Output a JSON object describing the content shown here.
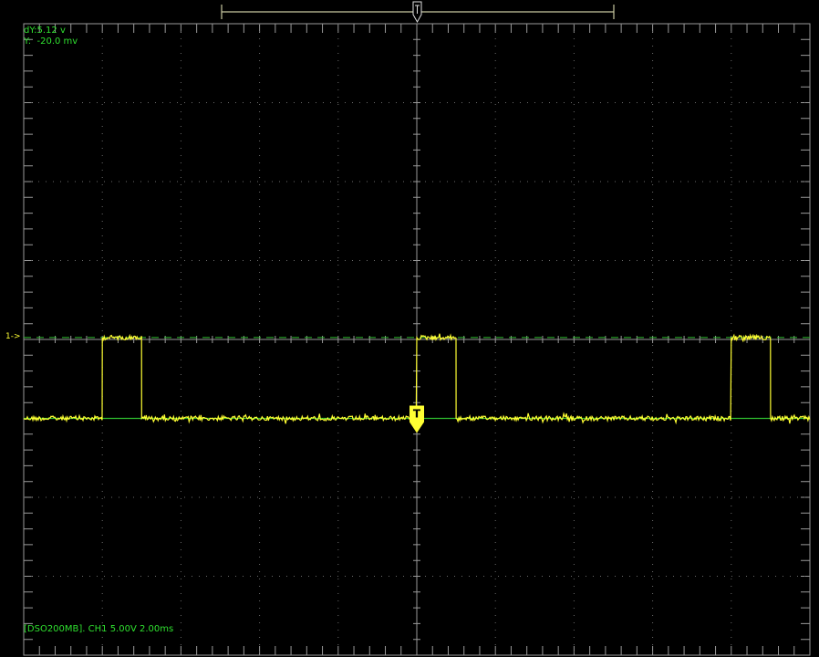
{
  "readouts": {
    "dy": "dY:5.12 v",
    "y": "Y:  -20.0 mv",
    "status": "[DSO200MB]. CH1 5.00V 2.00ms"
  },
  "channel_marker": "1->",
  "trigger_label": "T",
  "colors": {
    "background": "#000000",
    "grid": "#9a9a9a",
    "trace": "#ffff33",
    "cursor": "#2fc02f",
    "text": "#2fe02f"
  },
  "chart_data": {
    "type": "line",
    "title": "",
    "xlabel": "",
    "ylabel": "",
    "volts_per_div": 5.0,
    "time_per_div_ms": 2.0,
    "divisions": {
      "x": 10,
      "y": 8
    },
    "xlim_ms": [
      -10,
      10
    ],
    "ylim_v": [
      -15,
      25
    ],
    "trigger_time_ms": 0,
    "cursor_y_v": [
      0,
      5.12
    ],
    "series": [
      {
        "x_ms": [
          -10.0,
          -8.0,
          -8.0,
          -7.0,
          -7.0,
          0.0,
          0.0,
          1.0,
          1.0,
          8.0,
          8.0,
          9.0,
          9.0,
          10.0
        ],
        "y_v": [
          0,
          0,
          5.12,
          5.12,
          0,
          0,
          5.12,
          5.12,
          0,
          0,
          5.12,
          5.12,
          0,
          0
        ]
      }
    ]
  }
}
